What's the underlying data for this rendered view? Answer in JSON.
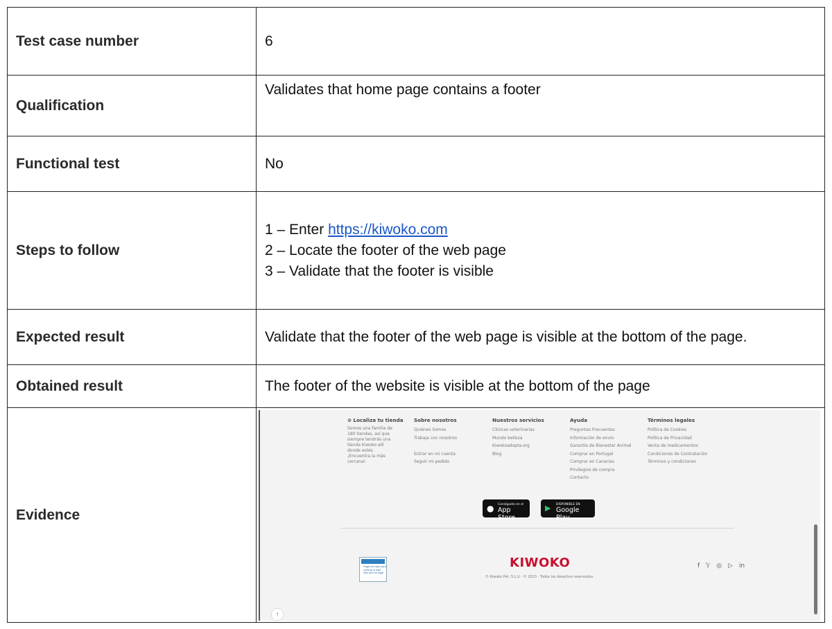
{
  "rows": [
    {
      "label": "Test case number",
      "value": "6"
    },
    {
      "label": "Qualification",
      "value": "Validates that home page contains a footer"
    },
    {
      "label": "Functional test",
      "value": "No"
    },
    {
      "label": "Steps to follow",
      "steps": {
        "s1_prefix": "1 – Enter ",
        "s1_link": "https://kiwoko.com",
        "s2": "2 – Locate the footer of the web page",
        "s3": "3 – Validate that the footer is visible"
      }
    },
    {
      "label": "Expected result",
      "value": "Validate that the footer of the web page is visible at the bottom of the page."
    },
    {
      "label": "Obtained result",
      "value": "The footer of the website is visible at the bottom of the page"
    },
    {
      "label": "Evidence"
    }
  ],
  "evidence": {
    "col1": {
      "title": "Localiza tu tienda",
      "text": "Somos una familia de 180 tiendas, así que siempre tendrás una tienda Kiwoko allí donde estés. ¡Encuentra la más cercana!"
    },
    "col2": {
      "title": "Sobre nosotros",
      "items": [
        "Quiénes Somos",
        "Trabaja con nosotros",
        "",
        "Entrar en mi cuenta",
        "Seguir mi pedido"
      ]
    },
    "col3": {
      "title": "Nuestros servicios",
      "items": [
        "Clínicas veterinarias",
        "Mundo belleza",
        "Kiwokoadopta.org",
        "Blog"
      ]
    },
    "col4": {
      "title": "Ayuda",
      "items": [
        "Preguntas Frecuentes",
        "Información de envío",
        "Garantía de Bienestar Animal",
        "Comprar en Portugal",
        "Comprar en Canarias",
        "Privilegios de compra",
        "Contacto"
      ]
    },
    "col5": {
      "title": "Términos legales",
      "items": [
        "Política de Cookies",
        "Política de Privacidad",
        "Venta de medicamentos",
        "Condiciones de Contratación",
        "Términos y condiciones"
      ]
    },
    "appstore": {
      "small": "Consíguelo en el",
      "big": "App Store"
    },
    "googleplay": {
      "small": "DISPONIBLE EN",
      "big": "Google Play"
    },
    "logo": "KIWOKO",
    "copyright": "© Kiwoko Pet, S.L.U - © 2023 - Todos los derechos reservados",
    "cert_text": "Haga clic aquí para verificar si este sitio web es legal",
    "social": [
      "f",
      "𝕐",
      "◎",
      "▷",
      "in"
    ]
  }
}
